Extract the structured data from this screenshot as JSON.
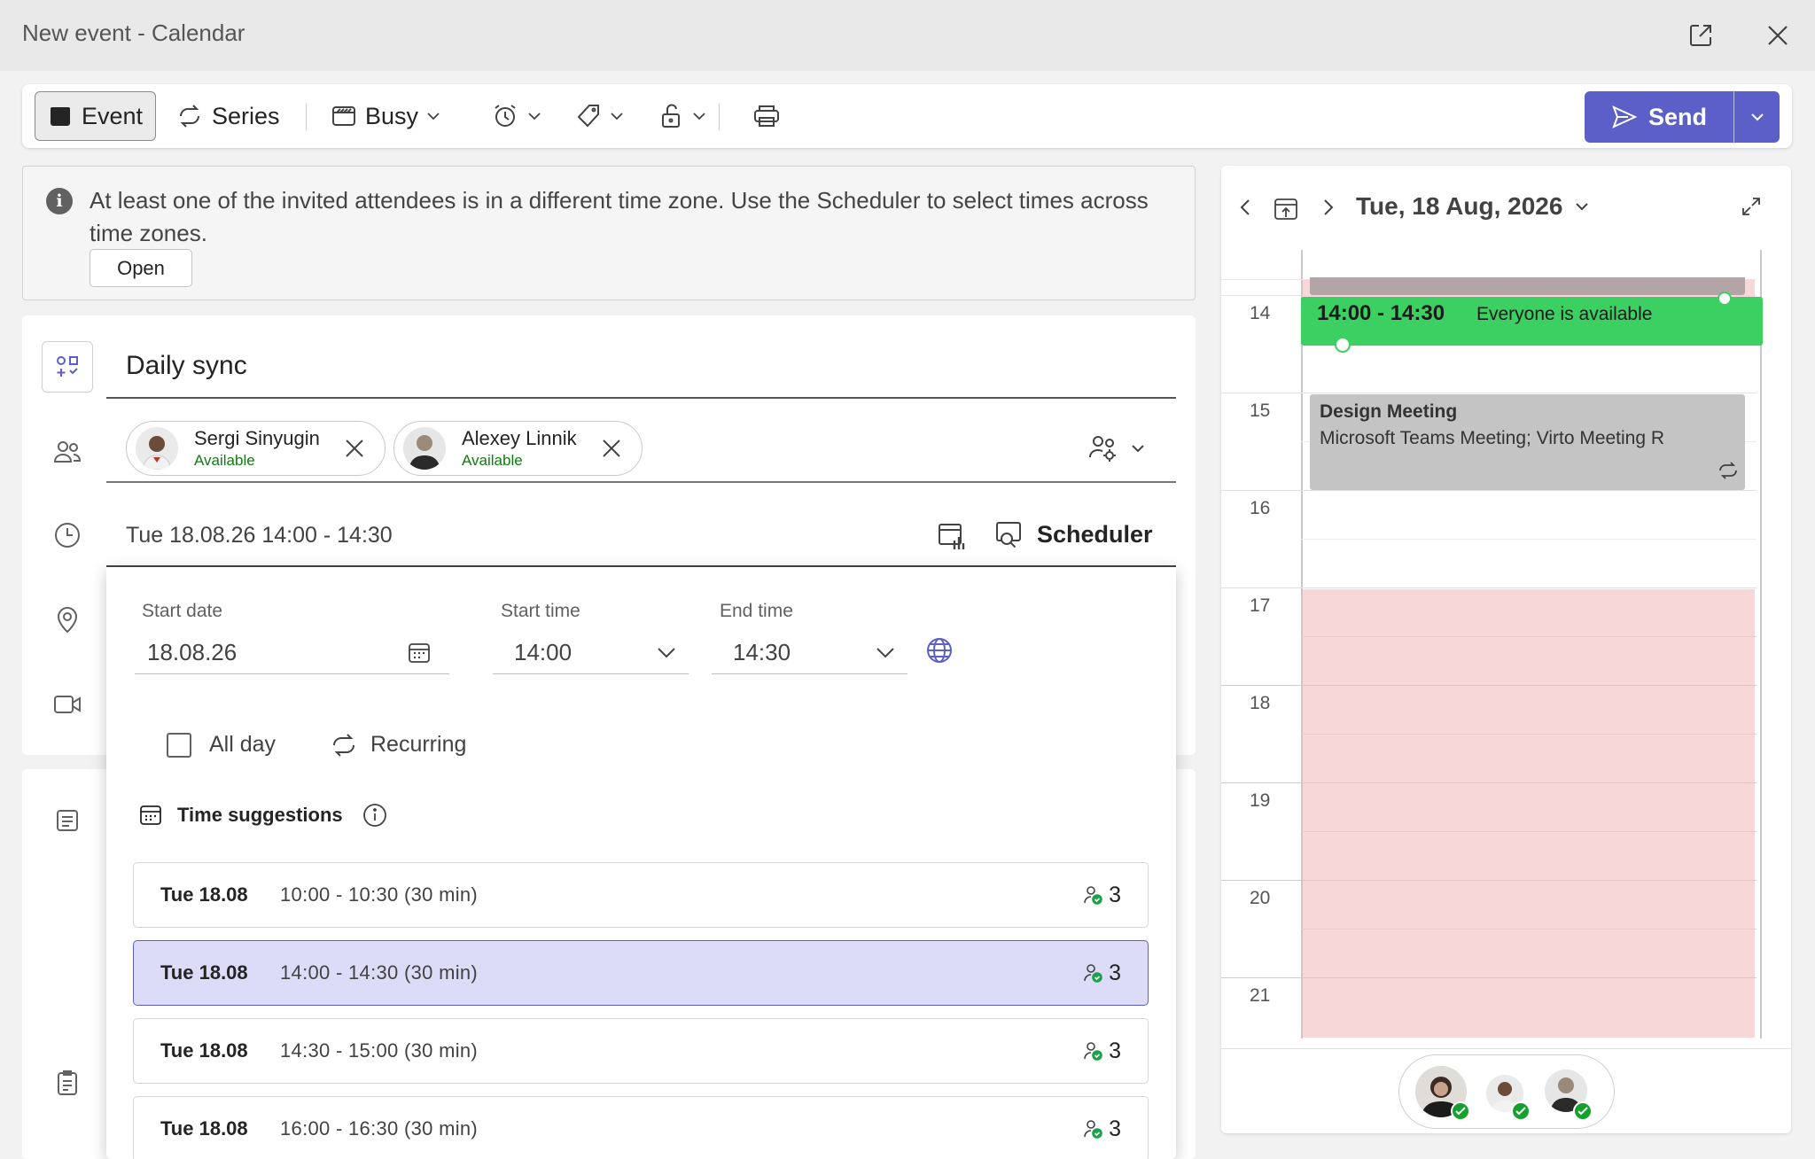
{
  "window": {
    "title": "New event - Calendar"
  },
  "toolbar": {
    "event_label": "Event",
    "series_label": "Series",
    "busy_label": "Busy",
    "send_label": "Send"
  },
  "banner": {
    "text": "At least one of the invited attendees is in a different time zone. Use the Scheduler to select times across time zones.",
    "open_label": "Open"
  },
  "form": {
    "title_value": "Daily sync",
    "attendees": [
      {
        "name": "Sergi Sinyugin",
        "status": "Available"
      },
      {
        "name": "Alexey Linnik",
        "status": "Available"
      }
    ],
    "datetime_summary": "Tue 18.08.26 14:00 - 14:30",
    "scheduler_label": "Scheduler"
  },
  "picker": {
    "start_date_label": "Start date",
    "start_date_value": "18.08.26",
    "start_time_label": "Start time",
    "start_time_value": "14:00",
    "end_time_label": "End time",
    "end_time_value": "14:30",
    "allday_label": "All day",
    "recurring_label": "Recurring",
    "suggestions_label": "Time suggestions",
    "suggestions": [
      {
        "day": "Tue 18.08",
        "time": "10:00 - 10:30 (30 min)",
        "count": "3",
        "selected": false
      },
      {
        "day": "Tue 18.08",
        "time": "14:00 - 14:30 (30 min)",
        "count": "3",
        "selected": true
      },
      {
        "day": "Tue 18.08",
        "time": "14:30 - 15:00 (30 min)",
        "count": "3",
        "selected": false
      },
      {
        "day": "Tue 18.08",
        "time": "16:00 - 16:30 (30 min)",
        "count": "3",
        "selected": false
      }
    ]
  },
  "day_view": {
    "date_label": "Tue, 18 Aug, 2026",
    "hours": [
      "14",
      "15",
      "16",
      "17",
      "18",
      "19",
      "20",
      "21"
    ],
    "new_event": {
      "time": "14:00 - 14:30",
      "note": "Everyone is available"
    },
    "design_meeting": {
      "title": "Design Meeting",
      "location": "Microsoft Teams Meeting; Virto Meeting R"
    }
  },
  "colors": {
    "accent": "#5b5fc7",
    "available_green": "#3ccf62",
    "busy_pink": "#f8d7d8",
    "status_green": "#107c10"
  }
}
